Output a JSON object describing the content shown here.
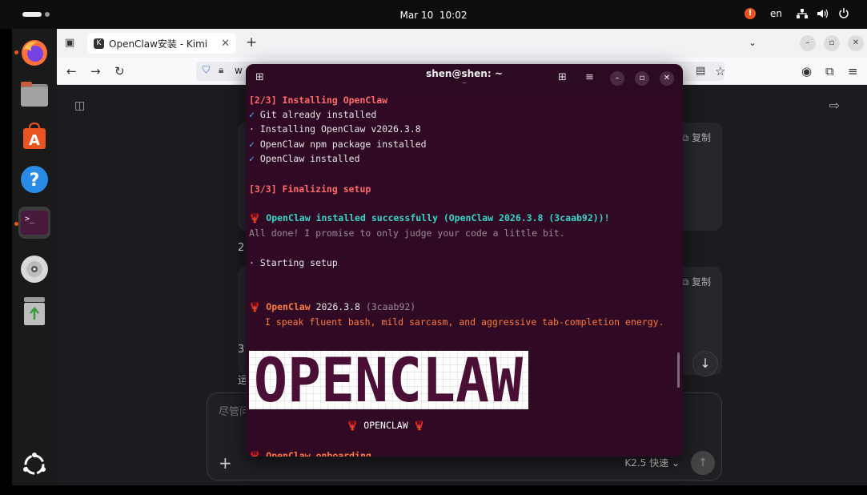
{
  "topbar": {
    "date": "Mar 10",
    "time": "10:02",
    "lang": "en"
  },
  "dock": {
    "items": [
      {
        "name": "firefox",
        "color": "#ff7139"
      },
      {
        "name": "files",
        "color": "#8b8b8b"
      },
      {
        "name": "app-center",
        "color": "#e95420"
      },
      {
        "name": "help",
        "color": "#2a8be6"
      },
      {
        "name": "terminal",
        "color": "#4a1a3e"
      },
      {
        "name": "disc",
        "color": "#cfcfcf"
      },
      {
        "name": "trash",
        "color": "#9a9a9a"
      }
    ]
  },
  "browser": {
    "tab_title": "OpenClaw安装 - Kimi",
    "tab_favicon": "K",
    "url_prefix": "w",
    "page": {
      "copy_label_1": "复制",
      "copy_label_2": "复制",
      "stub_2": "2",
      "stub_3": "3",
      "stub_4": "运",
      "input_placeholder": "尽管问",
      "model_label": "K2.5 快速"
    }
  },
  "terminal": {
    "title": "shen@shen: ~",
    "subtitle": "~",
    "lines": {
      "l1": "[2/3] Installing OpenClaw",
      "l2": "Git already installed",
      "l3": "· Installing OpenClaw v2026.3.8",
      "l4": "OpenClaw npm package installed",
      "l5": "OpenClaw installed",
      "l6": "[3/3] Finalizing setup",
      "l7": "OpenClaw installed successfully (OpenClaw 2026.3.8 (3caab92))!",
      "l8": "All done! I promise to only judge your code a little bit.",
      "l9": "· Starting setup",
      "l10a": "OpenClaw",
      "l10b": " 2026.3.8 ",
      "l10c": "(3caab92)",
      "l11": "I speak fluent bash, mild sarcasm, and aggressive tab-completion energy.",
      "logo_text": "OPENCLAW",
      "logo_label": "OPENCLAW",
      "l12": "OpenClaw onboarding"
    },
    "tick": "✓",
    "claw": "🦞"
  },
  "colors": {
    "terminal_bg": "#300a24",
    "accent": "#e95420"
  }
}
